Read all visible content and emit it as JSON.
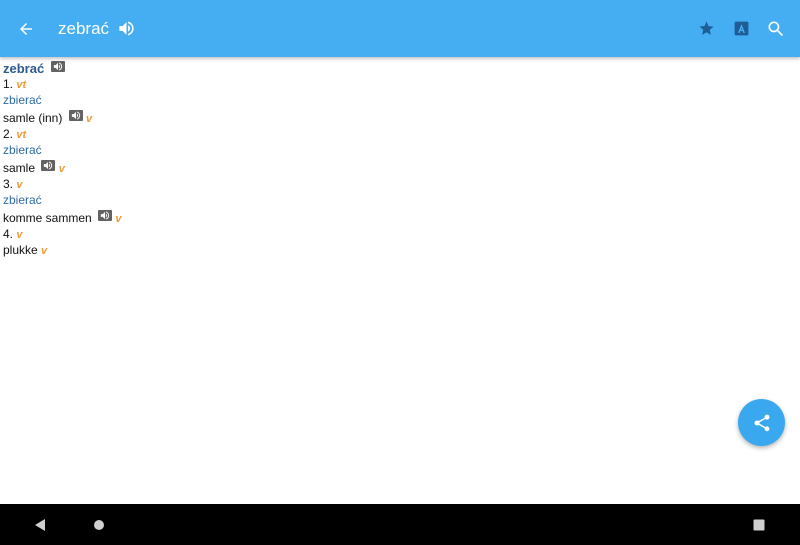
{
  "appbar": {
    "title": "zebrać",
    "icons": [
      "back-arrow-icon",
      "speaker-icon",
      "star-icon",
      "translate-icon",
      "search-icon"
    ],
    "color": "#45adf1"
  },
  "entry": {
    "headword": "zebrać",
    "senses": [
      {
        "number": "1.",
        "pos": "vt",
        "related": "zbierać",
        "translation": "samle (inn)",
        "translation_pos": "v"
      },
      {
        "number": "2.",
        "pos": "vt",
        "related": "zbierać",
        "translation": "samle",
        "translation_pos": "v"
      },
      {
        "number": "3.",
        "pos": "v",
        "related": "zbierać",
        "translation": "komme sammen",
        "translation_pos": "v"
      },
      {
        "number": "4.",
        "pos": "v",
        "translation": "plukke",
        "translation_pos": "v"
      }
    ]
  },
  "fab": {
    "icon": "share-icon",
    "color": "#3aa8ef"
  },
  "navbar": {
    "icons": [
      "nav-back-icon",
      "nav-home-icon",
      "nav-recents-icon"
    ]
  }
}
